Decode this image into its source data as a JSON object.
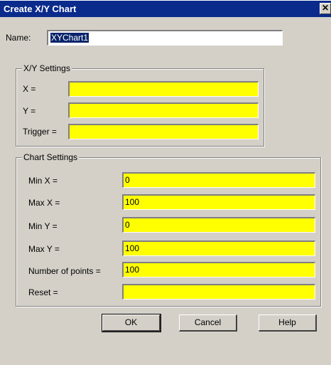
{
  "window": {
    "title": "Create X/Y Chart",
    "close_glyph": "✕"
  },
  "name": {
    "label": "Name:",
    "value": "XYChart1"
  },
  "xy_settings": {
    "title": "X/Y Settings",
    "x_label": "X =",
    "x_value": "",
    "y_label": "Y =",
    "y_value": "",
    "trigger_label": "Trigger =",
    "trigger_value": ""
  },
  "chart_settings": {
    "title": "Chart Settings",
    "min_x_label": "Min X =",
    "min_x_value": "0",
    "max_x_label": "Max X =",
    "max_x_value": "100",
    "min_y_label": "Min Y =",
    "min_y_value": "0",
    "max_y_label": "Max Y =",
    "max_y_value": "100",
    "points_label": "Number of points =",
    "points_value": "100",
    "reset_label": "Reset =",
    "reset_value": ""
  },
  "buttons": {
    "ok": "OK",
    "cancel": "Cancel",
    "help": "Help"
  }
}
